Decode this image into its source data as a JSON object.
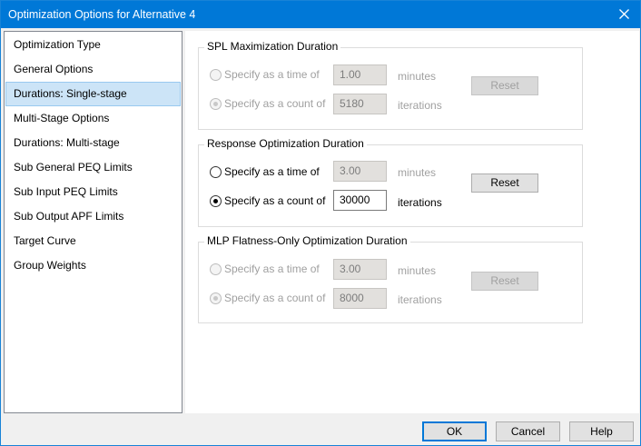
{
  "window": {
    "title": "Optimization Options for Alternative 4"
  },
  "nav": {
    "items": [
      "Optimization Type",
      "General Options",
      "Durations: Single-stage",
      "Multi-Stage Options",
      "Durations: Multi-stage",
      "Sub General PEQ Limits",
      "Sub Input PEQ Limits",
      "Sub Output APF Limits",
      "Target Curve",
      "Group Weights"
    ],
    "selected": "Durations: Single-stage"
  },
  "groups": {
    "spl": {
      "title": "SPL Maximization Duration",
      "time_label": "Specify as a time of",
      "time_value": "1.00",
      "time_unit": "minutes",
      "count_label": "Specify as a count of",
      "count_value": "5180",
      "count_unit": "iterations",
      "reset_label": "Reset"
    },
    "response": {
      "title": "Response Optimization Duration",
      "time_label": "Specify as a time of",
      "time_value": "3.00",
      "time_unit": "minutes",
      "count_label": "Specify as a count of",
      "count_value": "30000",
      "count_unit": "iterations",
      "reset_label": "Reset"
    },
    "mlp": {
      "title": "MLP Flatness-Only Optimization Duration",
      "time_label": "Specify as a time of",
      "time_value": "3.00",
      "time_unit": "minutes",
      "count_label": "Specify as a count of",
      "count_value": "8000",
      "count_unit": "iterations",
      "reset_label": "Reset"
    }
  },
  "footer": {
    "ok_label": "OK",
    "cancel_label": "Cancel",
    "help_label": "Help"
  },
  "colors": {
    "titlebar": "#0078d7",
    "selection": "#cce4f7"
  }
}
